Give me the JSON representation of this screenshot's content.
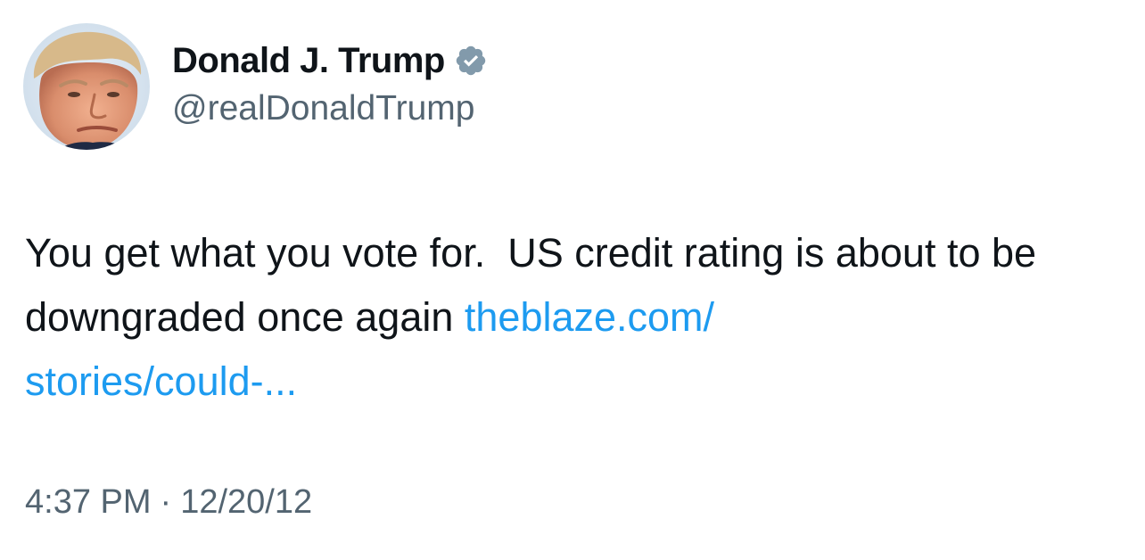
{
  "author": {
    "display_name": "Donald J. Trump",
    "handle": "@realDonaldTrump",
    "verified": true,
    "verified_badge_color": "#829aab"
  },
  "tweet": {
    "text": "You get what you vote for.  US credit rating is about to be downgraded once again ",
    "link_text": "theblaze.com/\nstories/could-...",
    "link_color": "#1d9bf0",
    "time": "4:37 PM",
    "separator": "·",
    "date": "12/20/12"
  },
  "icons": {
    "verified": "verified-badge-icon",
    "avatar": "profile-photo"
  }
}
